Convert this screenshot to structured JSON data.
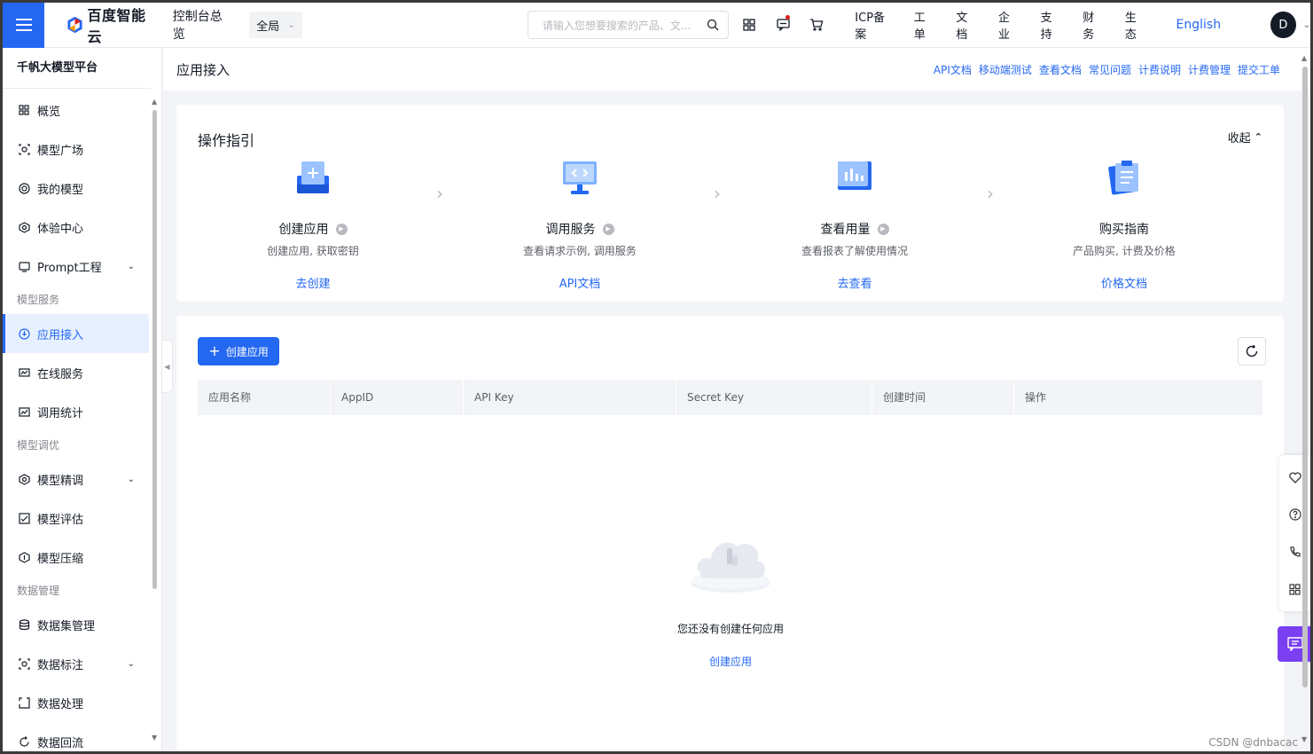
{
  "topbar": {
    "brand": "百度智能云",
    "console": "控制台总览",
    "region": "全局",
    "search_placeholder": "请输入您想要搜索的产品、文...",
    "links": [
      "ICP备案",
      "工单",
      "文档",
      "企业",
      "支持",
      "财务",
      "生态"
    ],
    "language": "English",
    "avatar_letter": "D"
  },
  "sidebar": {
    "title": "千帆大模型平台",
    "items": [
      {
        "label": "概览",
        "icon": "grid-icon"
      },
      {
        "label": "模型广场",
        "icon": "model-square-icon"
      },
      {
        "label": "我的模型",
        "icon": "my-model-icon"
      },
      {
        "label": "体验中心",
        "icon": "experience-icon"
      },
      {
        "label": "Prompt工程",
        "icon": "prompt-icon"
      }
    ],
    "group_service": "模型服务",
    "service_items": [
      {
        "label": "应用接入",
        "icon": "app-access-icon"
      },
      {
        "label": "在线服务",
        "icon": "online-service-icon"
      },
      {
        "label": "调用统计",
        "icon": "stats-icon"
      }
    ],
    "group_tune": "模型调优",
    "tune_items": [
      {
        "label": "模型精调",
        "icon": "finetune-icon"
      },
      {
        "label": "模型评估",
        "icon": "evaluate-icon"
      },
      {
        "label": "模型压缩",
        "icon": "compress-icon"
      }
    ],
    "group_data": "数据管理",
    "data_items": [
      {
        "label": "数据集管理",
        "icon": "dataset-icon"
      },
      {
        "label": "数据标注",
        "icon": "annotate-icon"
      },
      {
        "label": "数据处理",
        "icon": "process-icon"
      },
      {
        "label": "数据回流",
        "icon": "reflow-icon"
      }
    ]
  },
  "header": {
    "title": "应用接入",
    "links": [
      "API文档",
      "移动端测试",
      "查看文档",
      "常见问题",
      "计费说明",
      "计费管理",
      "提交工单"
    ]
  },
  "guide": {
    "title": "操作指引",
    "collapse": "收起",
    "steps": [
      {
        "name": "创建应用",
        "desc": "创建应用, 获取密钥",
        "link": "去创建"
      },
      {
        "name": "调用服务",
        "desc": "查看请求示例, 调用服务",
        "link": "API文档"
      },
      {
        "name": "查看用量",
        "desc": "查看报表了解使用情况",
        "link": "去查看"
      },
      {
        "name": "购买指南",
        "desc": "产品购买, 计费及价格",
        "link": "价格文档"
      }
    ]
  },
  "apps": {
    "create_button": "创建应用",
    "columns": [
      "应用名称",
      "AppID",
      "API Key",
      "Secret Key",
      "创建时间",
      "操作"
    ],
    "empty_text": "您还没有创建任何应用",
    "empty_link": "创建应用"
  },
  "watermark": "CSDN @dnbacac",
  "colors": {
    "accent": "#2468f2",
    "chat": "#7b3ff2"
  }
}
